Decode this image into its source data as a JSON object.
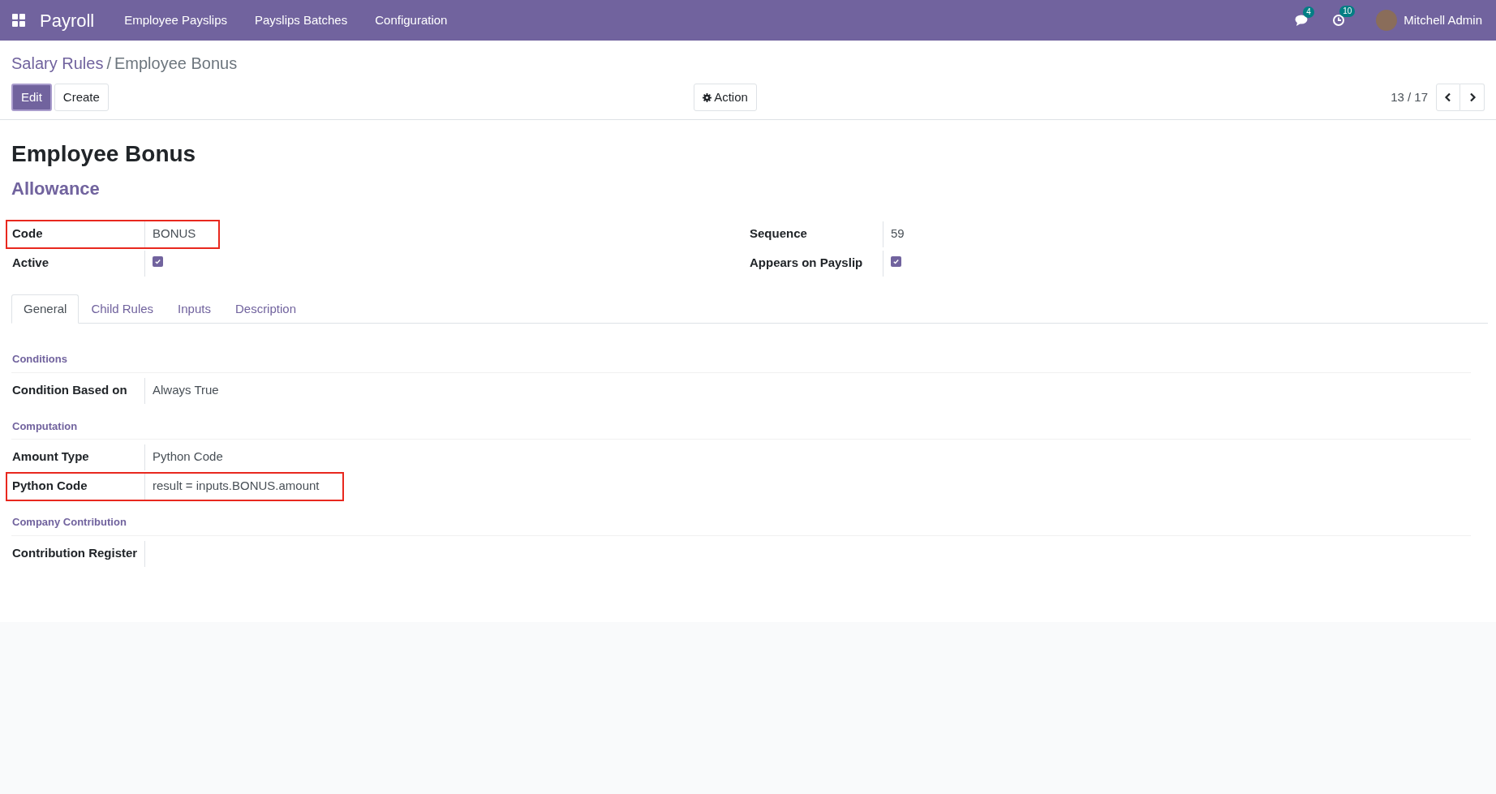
{
  "navbar": {
    "app_name": "Payroll",
    "menu": [
      "Employee Payslips",
      "Payslips Batches",
      "Configuration"
    ],
    "messages_badge": "4",
    "activities_badge": "10",
    "user": "Mitchell Admin"
  },
  "breadcrumb": {
    "items": [
      "Salary Rules",
      "Employee Bonus"
    ],
    "separator": "/"
  },
  "toolbar": {
    "edit": "Edit",
    "create": "Create",
    "action": "Action",
    "pager": "13 / 17"
  },
  "record": {
    "title": "Employee Bonus",
    "category": "Allowance"
  },
  "fields_left": [
    {
      "label": "Code",
      "kind": "text",
      "value": "BONUS",
      "highlighted": true
    },
    {
      "label": "Active",
      "kind": "checkbox",
      "checked": true,
      "highlighted": false
    }
  ],
  "fields_right": [
    {
      "label": "Sequence",
      "kind": "text",
      "value": "59",
      "highlighted": false
    },
    {
      "label": "Appears on Payslip",
      "kind": "checkbox",
      "checked": true,
      "highlighted": false
    }
  ],
  "tabs": [
    {
      "label": "General",
      "selected": true
    },
    {
      "label": "Child Rules",
      "selected": false
    },
    {
      "label": "Inputs",
      "selected": false
    },
    {
      "label": "Description",
      "selected": false
    }
  ],
  "sections": [
    {
      "title": "Conditions",
      "fields": [
        {
          "label": "Condition Based on",
          "kind": "text",
          "value": "Always True",
          "highlighted": false
        }
      ]
    },
    {
      "title": "Computation",
      "fields": [
        {
          "label": "Amount Type",
          "kind": "text",
          "value": "Python Code",
          "highlighted": false
        },
        {
          "label": "Python Code",
          "kind": "text",
          "value": "result = inputs.BONUS.amount",
          "highlighted": true
        }
      ]
    },
    {
      "title": "Company Contribution",
      "fields": [
        {
          "label": "Contribution Register",
          "kind": "text",
          "highlighted": false
        }
      ]
    }
  ]
}
